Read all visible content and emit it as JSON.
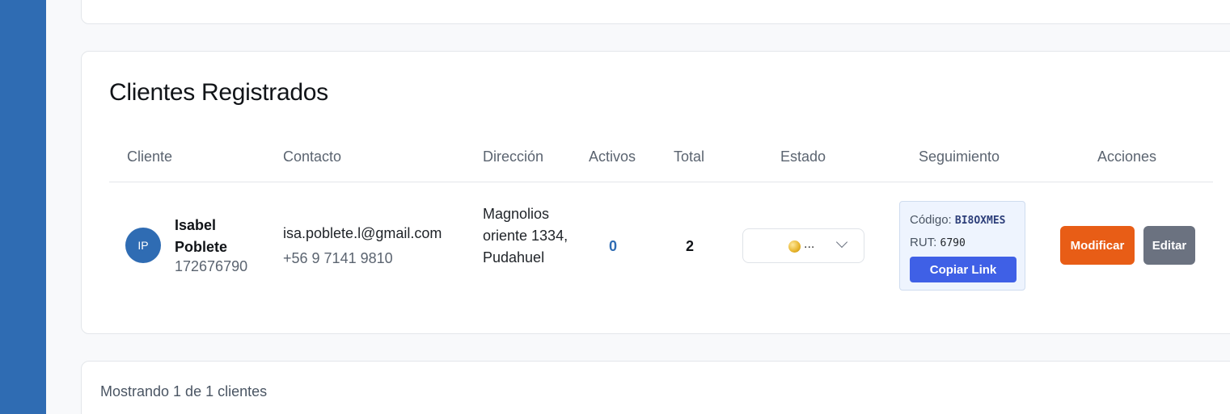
{
  "section": {
    "title": "Clientes Registrados"
  },
  "table": {
    "headers": {
      "cliente": "Cliente",
      "contacto": "Contacto",
      "direccion": "Dirección",
      "activos": "Activos",
      "total": "Total",
      "estado": "Estado",
      "seguimiento": "Seguimiento",
      "acciones": "Acciones"
    },
    "rows": [
      {
        "initials": "IP",
        "name": "Isabel Poblete",
        "id": "172676790",
        "email": "isa.poblete.l@gmail.com",
        "phone": "+56 9 7141 9810",
        "address": "Magnolios oriente 1334, Pudahuel",
        "activos": "0",
        "total": "2",
        "estado": "...",
        "tracking": {
          "code_label": "Código:",
          "code": "BI8OXMES",
          "rut_label": "RUT:",
          "rut": "6790",
          "copy_label": "Copiar Link"
        },
        "actions": {
          "modify": "Modificar",
          "edit": "Editar"
        }
      }
    ]
  },
  "footer": {
    "summary": "Mostrando 1 de 1 clientes"
  },
  "colors": {
    "sidebar": "#2f6cb3",
    "modify": "#e85d16",
    "edit": "#6b7280",
    "copy": "#3f60e6",
    "activos": "#2f6cb3"
  }
}
